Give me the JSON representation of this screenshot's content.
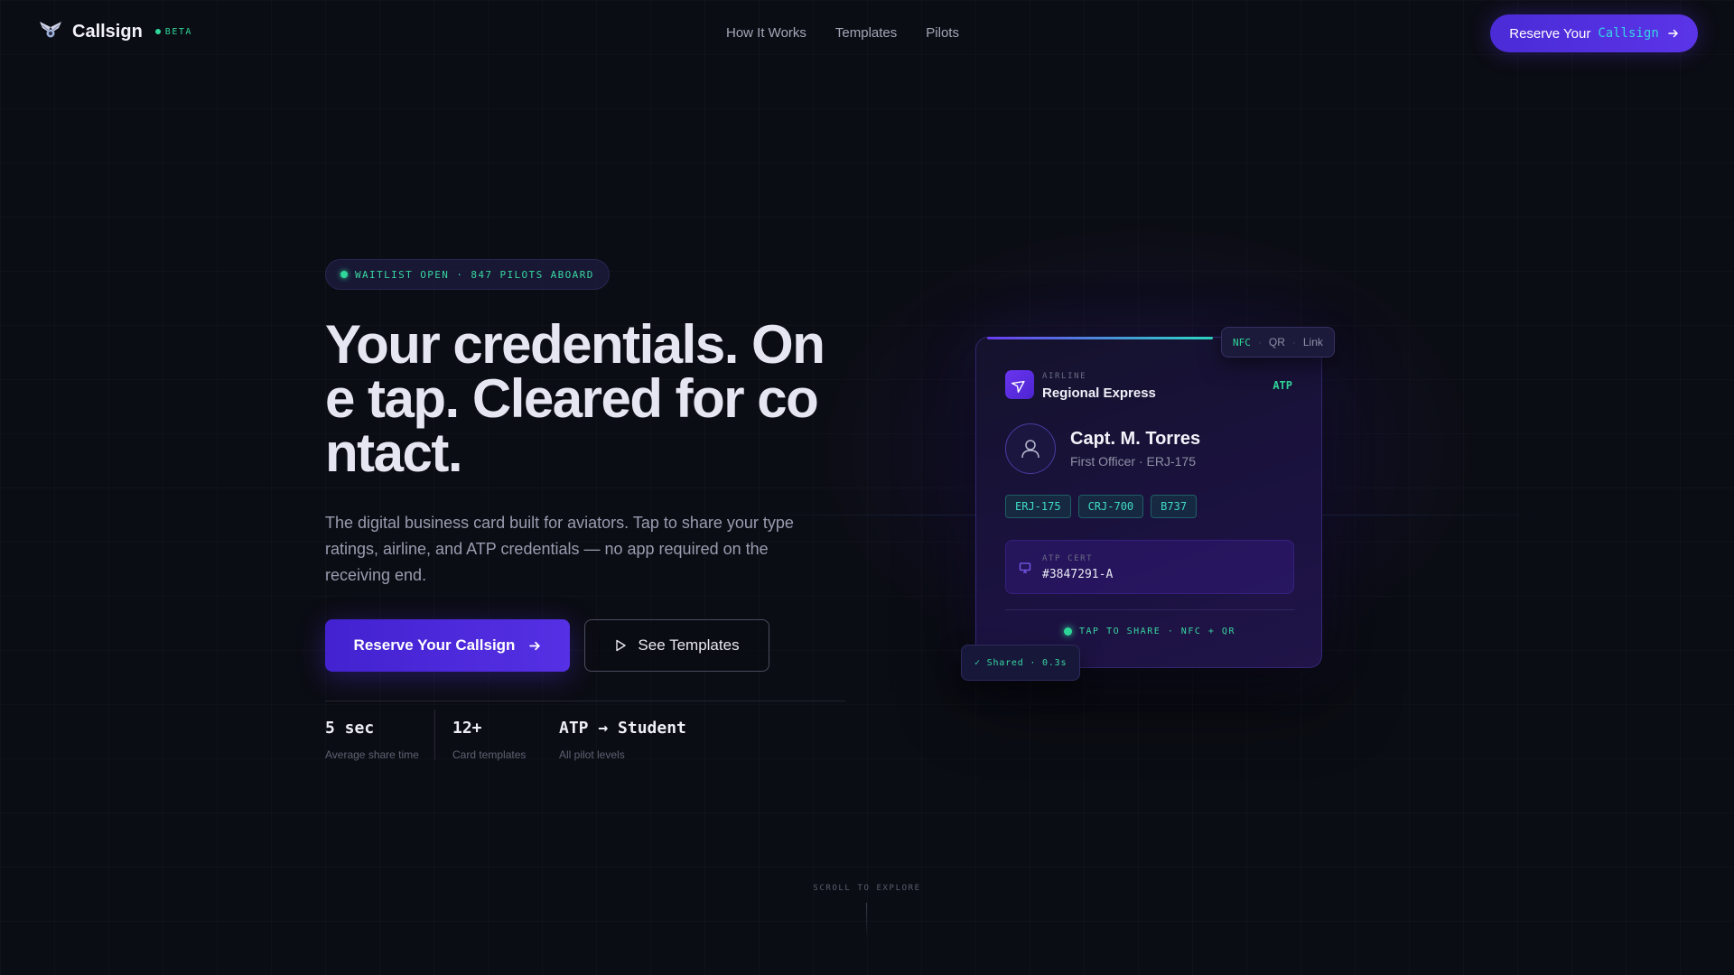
{
  "nav": {
    "brand": "Callsign",
    "beta": "BETA",
    "links": [
      "How It Works",
      "Templates",
      "Pilots"
    ],
    "cta_prefix": "Reserve Your",
    "cta_mono": "Callsign"
  },
  "hero": {
    "badge": "WAITLIST OPEN · 847 PILOTS ABOARD",
    "headline": "Your credentials. One tap. Cleared for contact.",
    "subhead": "The digital business card built for aviators. Tap to share your type ratings, airline, and ATP credentials — no app required on the receiving end.",
    "primary_cta": "Reserve Your Callsign",
    "secondary_cta": "See Templates",
    "stats": [
      {
        "value": "5 sec",
        "label": "Average share time"
      },
      {
        "value": "12+",
        "label": "Card templates"
      },
      {
        "value": "ATP → Student",
        "label": "All pilot levels"
      }
    ],
    "scroll_hint": "SCROLL TO EXPLORE"
  },
  "card": {
    "airline_kicker": "AIRLINE",
    "airline_name": "Regional Express",
    "level_badge": "ATP",
    "pilot_name": "Capt. M. Torres",
    "pilot_role": "First Officer · ERJ-175",
    "ratings": [
      "ERJ-175",
      "CRJ-700",
      "B737"
    ],
    "cert_kicker": "ATP CERT",
    "cert_number": "#3847291-A",
    "tap_label": "TAP TO SHARE · NFC + QR",
    "share_modes": [
      "NFC",
      "QR",
      "Link"
    ],
    "shared_toast": "✓ Shared · 0.3s"
  },
  "colors": {
    "background": "#0b0d14",
    "accent": "#5530e4",
    "success": "#2fd79a",
    "teal": "#3fdcc4"
  }
}
